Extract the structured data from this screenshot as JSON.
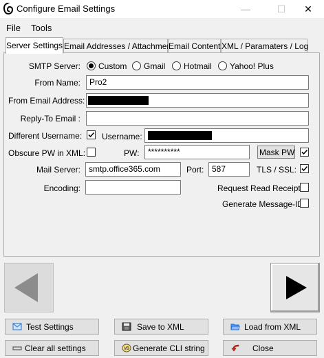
{
  "window": {
    "title": "Configure Email Settings",
    "minimize_glyph": "—",
    "maximize_glyph": "☐",
    "close_glyph": "✕"
  },
  "menu": {
    "file": "File",
    "tools": "Tools"
  },
  "tabs": [
    {
      "label": "Server Settings",
      "active": true
    },
    {
      "label": "Email Addresses / Attachment",
      "active": false
    },
    {
      "label": "Email Content",
      "active": false
    },
    {
      "label": "XML / Paramaters / Log",
      "active": false
    }
  ],
  "form": {
    "smtp_server_label": "SMTP Server:",
    "smtp_options": [
      {
        "label": "Custom",
        "selected": true
      },
      {
        "label": "Gmail",
        "selected": false
      },
      {
        "label": "Hotmail",
        "selected": false
      },
      {
        "label": "Yahoo! Plus",
        "selected": false
      }
    ],
    "from_name_label": "From Name:",
    "from_name_value": "Pro2",
    "from_email_label": "From Email Address:",
    "reply_to_label": "Reply-To Email :",
    "reply_to_value": "",
    "different_username_label": "Different Username:",
    "different_username_checked": true,
    "username_label": "Username:",
    "obscure_pw_label": "Obscure PW in XML:",
    "obscure_pw_checked": false,
    "pw_label": "PW:",
    "pw_value": "**********",
    "mask_pw_label": "Mask PW",
    "mask_pw_checked": true,
    "mail_server_label": "Mail Server:",
    "mail_server_value": "smtp.office365.com",
    "port_label": "Port:",
    "port_value": "587",
    "tls_ssl_label": "TLS / SSL:",
    "tls_ssl_checked": true,
    "encoding_label": "Encoding:",
    "encoding_value": "",
    "read_receipt_label": "Request Read Receipt:",
    "read_receipt_checked": false,
    "message_id_label": "Generate Message-ID",
    "message_id_checked": false
  },
  "nav": {
    "prev_icon": "left-arrow-icon",
    "next_icon": "right-arrow-icon"
  },
  "buttons": {
    "test_settings": "Test Settings",
    "save_xml": "Save to XML",
    "load_xml": "Load from XML",
    "clear_all": "Clear all settings",
    "generate_cli": "Generate CLI string",
    "close": "Close"
  },
  "colors": {
    "accent_blue": "#1e6fd0",
    "close_red": "#d0281e",
    "disabled_arrow": "#8c8c8c"
  }
}
